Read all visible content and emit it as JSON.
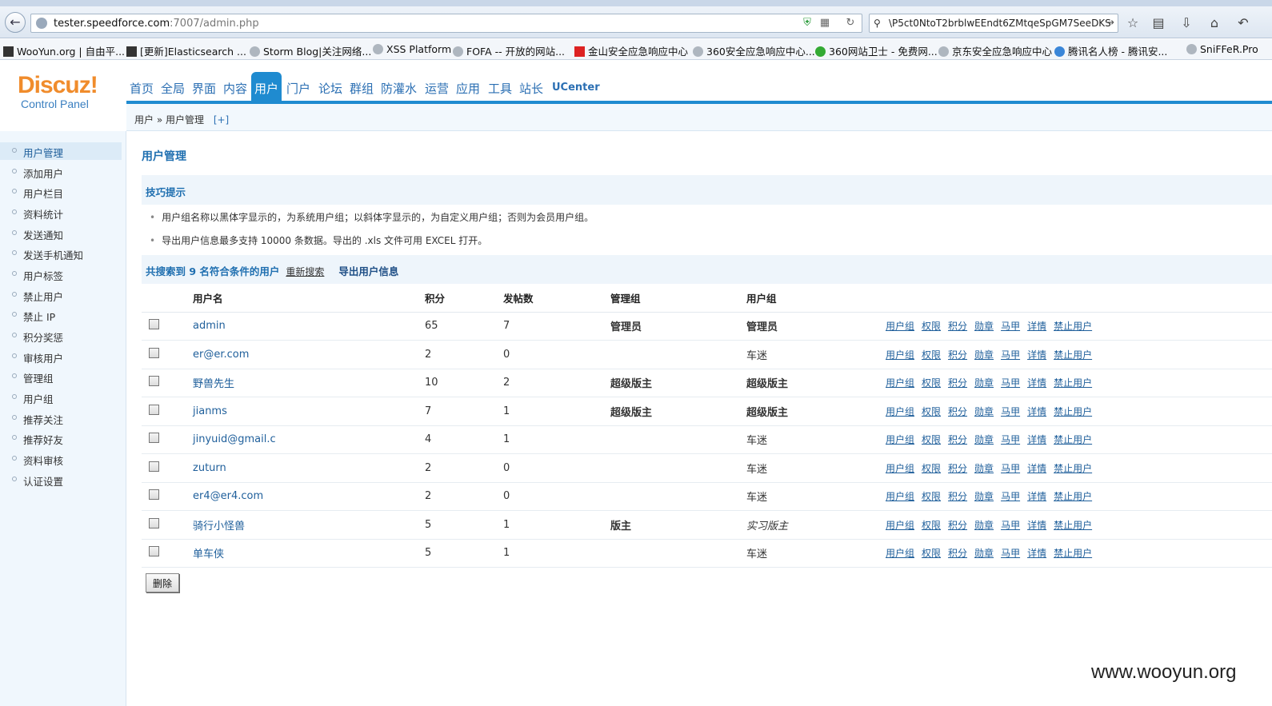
{
  "browser": {
    "url_host": "tester.speedforce.com",
    "url_rest": ":7007/admin.php",
    "search_text": "\\P5ct0NtoT2brblwEEndt6ZMtqeSpGM7SeeDKS",
    "bookmarks": [
      "WooYun.org | 自由平...",
      "[更新]Elasticsearch ...",
      "Storm Blog|关注网络...",
      "XSS Platform",
      "FOFA -- 开放的网站...",
      "金山安全应急响应中心",
      "360安全应急响应中心...",
      "360网站卫士 - 免费网...",
      "京东安全应急响应中心",
      "腾讯名人榜 - 腾讯安...",
      "SniFFeR.Pro"
    ]
  },
  "logo": {
    "main": "Discuz!",
    "sub": "Control Panel"
  },
  "nav": [
    "首页",
    "全局",
    "界面",
    "内容",
    "用户",
    "门户",
    "论坛",
    "群组",
    "防灌水",
    "运营",
    "应用",
    "工具",
    "站长",
    "UCenter"
  ],
  "breadcrumb": {
    "path": "用户 » 用户管理",
    "plus": "[+]"
  },
  "sidebar": [
    "用户管理",
    "添加用户",
    "用户栏目",
    "资料统计",
    "发送通知",
    "发送手机通知",
    "用户标签",
    "禁止用户",
    "禁止 IP",
    "积分奖惩",
    "审核用户",
    "管理组",
    "用户组",
    "推荐关注",
    "推荐好友",
    "资料审核",
    "认证设置"
  ],
  "page_title": "用户管理",
  "tips": {
    "title": "技巧提示",
    "lines": [
      "用户组名称以黑体字显示的，为系统用户组；以斜体字显示的，为自定义用户组；否则为会员用户组。",
      "导出用户信息最多支持 10000 条数据。导出的 .xls 文件可用 EXCEL 打开。"
    ]
  },
  "results": {
    "count_text": "共搜索到 9 名符合条件的用户",
    "research": "重新搜索",
    "export": "导出用户信息"
  },
  "table": {
    "headers": [
      "用户名",
      "积分",
      "发帖数",
      "管理组",
      "用户组"
    ],
    "rows": [
      {
        "name": "admin",
        "credits": "65",
        "posts": "7",
        "admin_group": "管理员",
        "user_group": "管理员",
        "ug_style": "bold"
      },
      {
        "name": "er@er.com",
        "credits": "2",
        "posts": "0",
        "admin_group": "",
        "user_group": "车迷",
        "ug_style": "normal"
      },
      {
        "name": "野兽先生",
        "credits": "10",
        "posts": "2",
        "admin_group": "超级版主",
        "user_group": "超级版主",
        "ug_style": "bold"
      },
      {
        "name": "jianms",
        "credits": "7",
        "posts": "1",
        "admin_group": "超级版主",
        "user_group": "超级版主",
        "ug_style": "bold"
      },
      {
        "name": "jinyuid@gmail.c",
        "credits": "4",
        "posts": "1",
        "admin_group": "",
        "user_group": "车迷",
        "ug_style": "normal"
      },
      {
        "name": "zuturn",
        "credits": "2",
        "posts": "0",
        "admin_group": "",
        "user_group": "车迷",
        "ug_style": "normal"
      },
      {
        "name": "er4@er4.com",
        "credits": "2",
        "posts": "0",
        "admin_group": "",
        "user_group": "车迷",
        "ug_style": "normal"
      },
      {
        "name": "骑行小怪兽",
        "credits": "5",
        "posts": "1",
        "admin_group": "版主",
        "user_group": "实习版主",
        "ug_style": "italic"
      },
      {
        "name": "单车侠",
        "credits": "5",
        "posts": "1",
        "admin_group": "",
        "user_group": "车迷",
        "ug_style": "normal"
      }
    ],
    "actions": [
      "用户组",
      "权限",
      "积分",
      "勋章",
      "马甲",
      "详情",
      "禁止用户"
    ]
  },
  "delete_label": "删除",
  "watermark": "www.wooyun.org"
}
